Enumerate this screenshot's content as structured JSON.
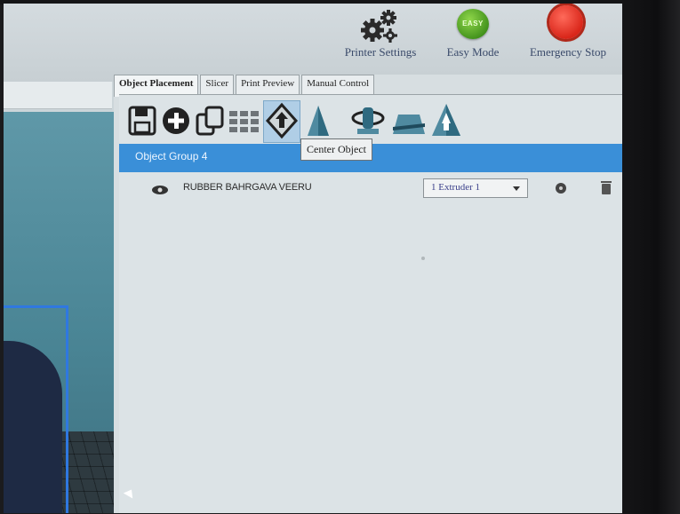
{
  "toolbar": {
    "printer_settings": "Printer Settings",
    "easy_mode": "Easy Mode",
    "easy_badge": "EASY",
    "emergency_stop": "Emergency Stop"
  },
  "tabs": [
    {
      "label": "Object Placement",
      "active": true
    },
    {
      "label": "Slicer",
      "active": false
    },
    {
      "label": "Print Preview",
      "active": false
    },
    {
      "label": "Manual Control",
      "active": false
    }
  ],
  "object_tools": [
    "save-icon",
    "add-object-icon",
    "copy-objects-icon",
    "autoposition-icon",
    "center-object-icon",
    "scale-icon",
    "rotate-icon",
    "cut-icon",
    "mirror-icon"
  ],
  "group": {
    "label": "Object Group 4"
  },
  "tooltip": "Center Object",
  "object": {
    "name": "RUBBER BAHRGAVA VEERU",
    "extruder": "1 Extruder 1"
  },
  "colors": {
    "accent": "#3a8fd8",
    "easy_green": "#4a9a20",
    "stop_red": "#d9261a"
  }
}
